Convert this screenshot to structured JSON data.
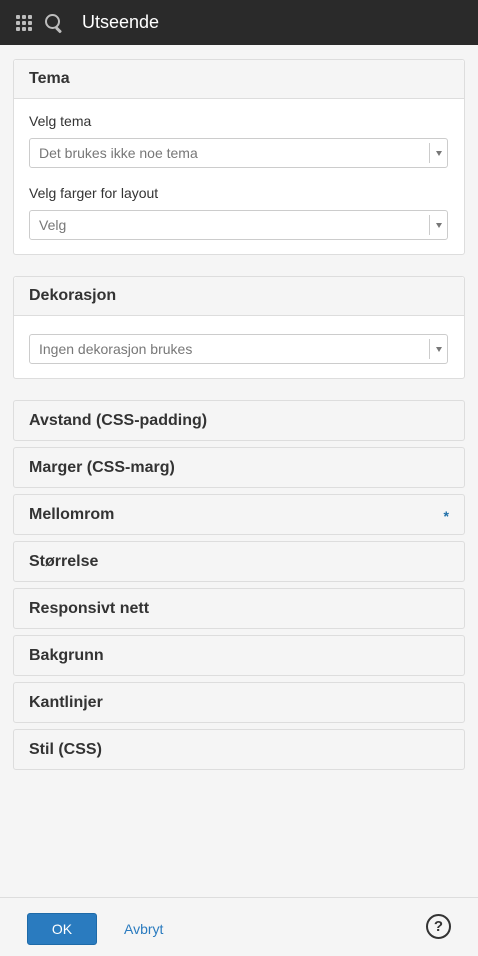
{
  "header": {
    "title": "Utseende"
  },
  "tema": {
    "title": "Tema",
    "theme_label": "Velg tema",
    "theme_value": "Det brukes ikke noe tema",
    "color_label": "Velg farger for layout",
    "color_value": "Velg"
  },
  "dekorasjon": {
    "title": "Dekorasjon",
    "value": "Ingen dekorasjon brukes"
  },
  "sections": [
    {
      "label": "Avstand (CSS-padding)"
    },
    {
      "label": "Marger (CSS-marg)"
    },
    {
      "label": "Mellomrom",
      "marker": "*"
    },
    {
      "label": "Størrelse"
    },
    {
      "label": "Responsivt nett"
    },
    {
      "label": "Bakgrunn"
    },
    {
      "label": "Kantlinjer"
    },
    {
      "label": "Stil (CSS)"
    }
  ],
  "footer": {
    "ok_label": "OK",
    "cancel_label": "Avbryt",
    "help_glyph": "?"
  },
  "icons": {
    "apps": "grid-icon",
    "search": "search-icon",
    "help": "help-icon",
    "dropdown": "caret-down-icon"
  },
  "colors": {
    "topbar": "#2a2a2a",
    "primary": "#2a7bbf",
    "marker": "#1f6fa8"
  }
}
